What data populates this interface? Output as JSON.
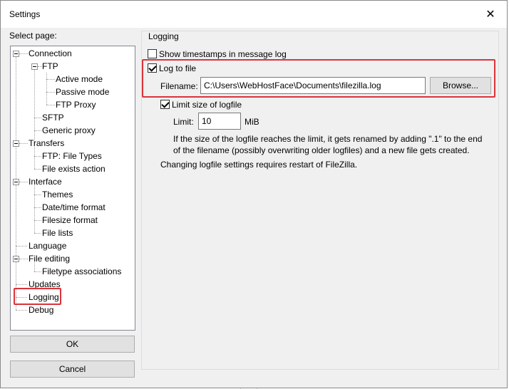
{
  "window": {
    "title": "Settings"
  },
  "tree": {
    "header": "Select page:",
    "items": [
      {
        "label": "Connection"
      },
      {
        "label": "FTP"
      },
      {
        "label": "Active mode"
      },
      {
        "label": "Passive mode"
      },
      {
        "label": "FTP Proxy"
      },
      {
        "label": "SFTP"
      },
      {
        "label": "Generic proxy"
      },
      {
        "label": "Transfers"
      },
      {
        "label": "FTP: File Types"
      },
      {
        "label": "File exists action"
      },
      {
        "label": "Interface"
      },
      {
        "label": "Themes"
      },
      {
        "label": "Date/time format"
      },
      {
        "label": "Filesize format"
      },
      {
        "label": "File lists"
      },
      {
        "label": "Language"
      },
      {
        "label": "File editing"
      },
      {
        "label": "Filetype associations"
      },
      {
        "label": "Updates"
      },
      {
        "label": "Logging"
      },
      {
        "label": "Debug"
      }
    ],
    "selected": "Logging"
  },
  "buttons": {
    "ok": "OK",
    "cancel": "Cancel",
    "browse": "Browse..."
  },
  "logging": {
    "group_title": "Logging",
    "show_timestamps_label": "Show timestamps in message log",
    "show_timestamps_checked": false,
    "log_to_file_label": "Log to file",
    "log_to_file_checked": true,
    "filename_label": "Filename:",
    "filename_value": "C:\\Users\\WebHostFace\\Documents\\filezilla.log",
    "limit_size_label": "Limit size of logfile",
    "limit_size_checked": true,
    "limit_label": "Limit:",
    "limit_value": "10",
    "limit_unit": "MiB",
    "info_line1": "If the size of the logfile reaches the limit, it gets renamed by adding \".1\" to the end",
    "info_line2": "of the filename (possibly overwriting older logfiles) and a new file gets created.",
    "restart_note": "Changing logfile settings requires restart of FileZilla."
  },
  "highlight_color": "#d9343a"
}
